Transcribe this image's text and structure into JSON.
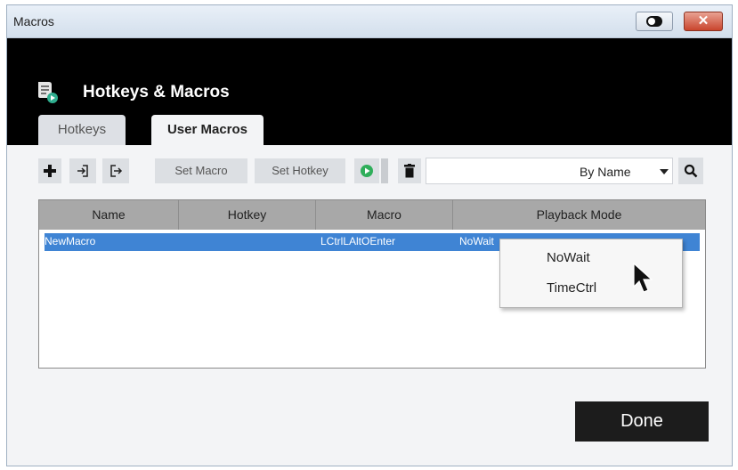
{
  "window": {
    "title": "Macros",
    "close_glyph": "✕",
    "colors": {
      "header_bg": "#000000",
      "selection": "#3f84d4",
      "close_button": "#c9452d",
      "done_button": "#1c1c1c"
    }
  },
  "header": {
    "title": "Hotkeys & Macros",
    "icon": "macro-script-icon"
  },
  "tabs": [
    {
      "label": "Hotkeys",
      "selected": false
    },
    {
      "label": "User Macros",
      "selected": true
    }
  ],
  "toolbar": {
    "add_icon": "plus-icon",
    "import_icon": "import-icon",
    "export_icon": "export-icon",
    "set_macro_label": "Set Macro",
    "set_hotkey_label": "Set Hotkey",
    "play_icon": "play-icon",
    "delete_icon": "trash-icon",
    "search_value": "",
    "sort_value": "By Name",
    "search_icon": "search-icon"
  },
  "table": {
    "columns": [
      "Name",
      "Hotkey",
      "Macro",
      "Playback Mode"
    ],
    "rows": [
      {
        "name": "NewMacro",
        "hotkey": "",
        "macro": "LCtrlLAltOEnter",
        "playback": "NoWait",
        "selected": true
      }
    ]
  },
  "playback_menu": {
    "options": [
      "NoWait",
      "TimeCtrl"
    ]
  },
  "footer": {
    "done_label": "Done"
  }
}
